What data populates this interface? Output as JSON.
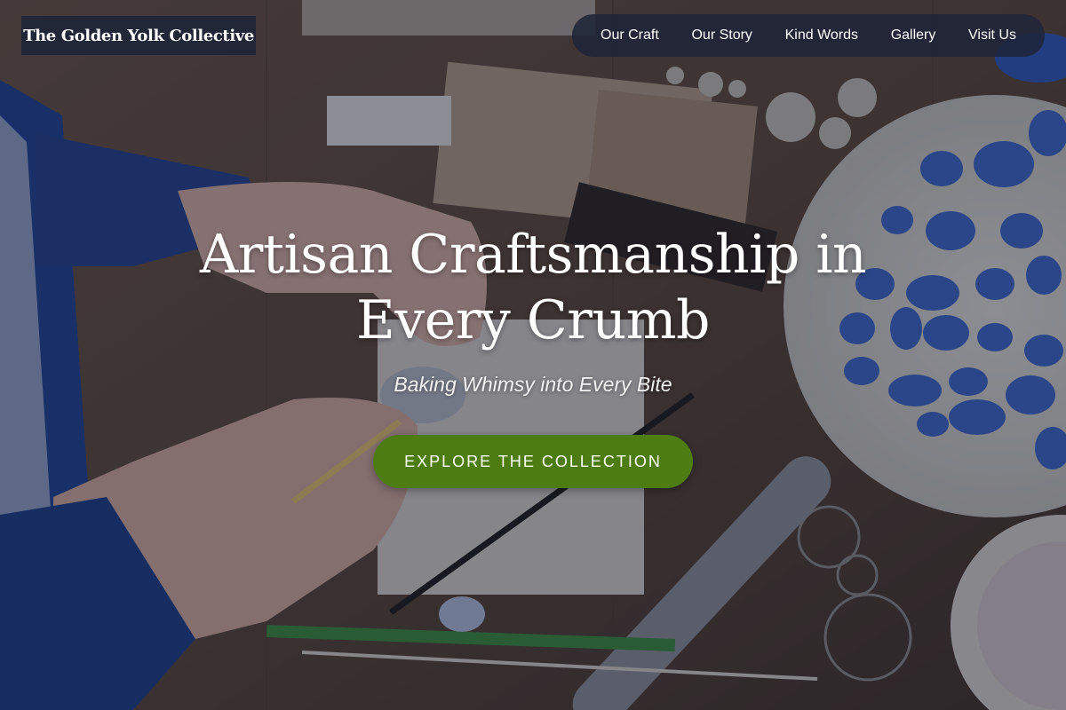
{
  "brand": {
    "name": "The Golden Yolk Collective"
  },
  "nav": {
    "items": [
      {
        "label": "Our Craft"
      },
      {
        "label": "Our Story"
      },
      {
        "label": "Kind Words"
      },
      {
        "label": "Gallery"
      },
      {
        "label": "Visit Us"
      }
    ]
  },
  "hero": {
    "title": "Artisan Craftsmanship in Every Crumb",
    "tagline": "Baking Whimsy into Every Bite",
    "cta_label": "EXPLORE THE COLLECTION",
    "background_image": "artisan-workbench-photo"
  },
  "colors": {
    "cta_background": "#4d7d12",
    "nav_background": "#1e2438",
    "overlay_tint": "#141a30",
    "text": "#ffffff"
  }
}
